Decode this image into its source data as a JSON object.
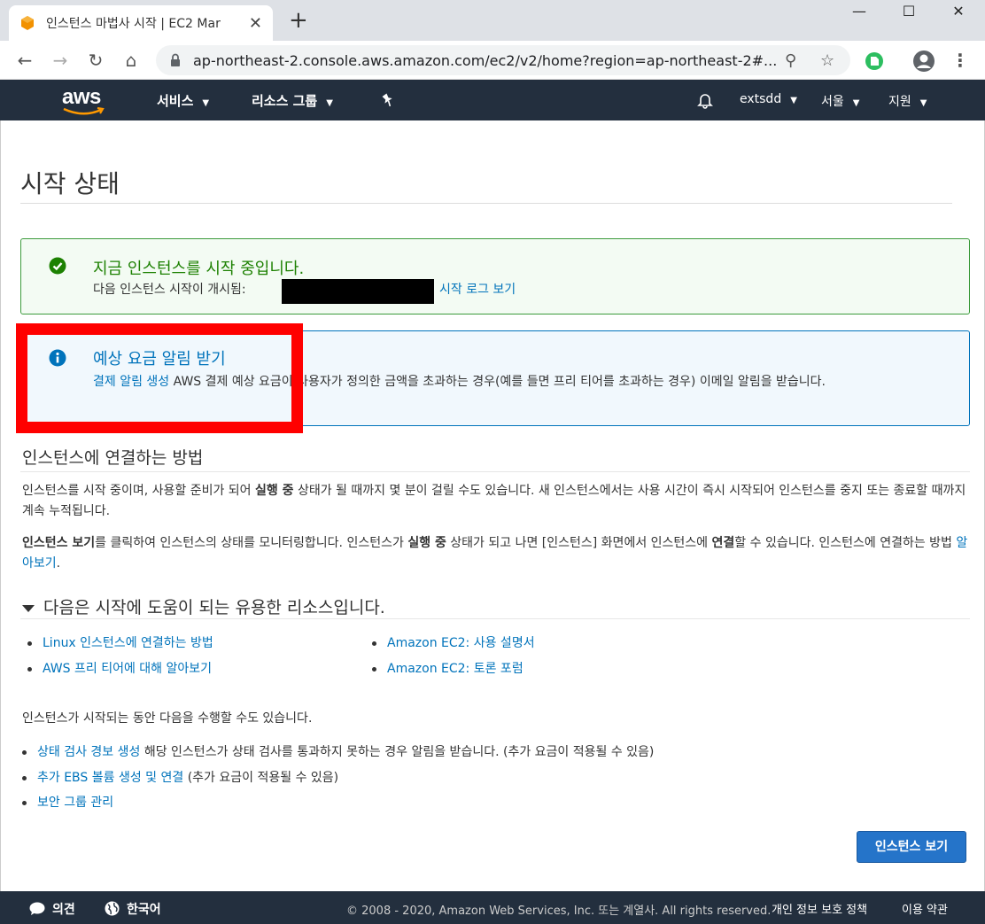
{
  "browser": {
    "tab_title": "인스턴스 마법사 시작 | EC2 Mar",
    "url": "ap-northeast-2.console.aws.amazon.com/ec2/v2/home?region=ap-northeast-2#..."
  },
  "aws_nav": {
    "logo": "aws",
    "services": "서비스",
    "resource_groups": "리소스 그룹",
    "account": "extsdd",
    "region": "서울",
    "support": "지원"
  },
  "page": {
    "title": "시작 상태",
    "success": {
      "title": "지금 인스턴스를 시작 중입니다.",
      "message": "다음 인스턴스 시작이 개시됨:",
      "log_link": "시작 로그 보기"
    },
    "info": {
      "title": "예상 요금 알림 받기",
      "link": "결제 알림 생성",
      "message": "AWS 결제 예상 요금이 사용자가 정의한 금액을 초과하는 경우(예를 들면 프리 티어를 초과하는 경우) 이메일 알림을 받습니다."
    },
    "connect": {
      "title": "인스턴스에 연결하는 방법",
      "p1_a": "인스턴스를 시작 중이며, 사용할 준비가 되어 ",
      "p1_bold": "실행 중",
      "p1_b": " 상태가 될 때까지 몇 분이 걸릴 수도 있습니다. 새 인스턴스에서는 사용 시간이 즉시 시작되어 인스턴스를 중지 또는 종료할 때까지 계속 누적됩니다.",
      "p2_bold1": "인스턴스 보기",
      "p2_a": "를 클릭하여 인스턴스의 상태를 모니터링합니다. 인스턴스가 ",
      "p2_bold2": "실행 중",
      "p2_b": " 상태가 되고 나면 [인스턴스] 화면에서 인스턴스에 ",
      "p2_bold3": "연결",
      "p2_c": "할 수 있습니다. 인스턴스에 연결하는 방법 ",
      "p2_link": "알아보기",
      "p2_end": "."
    },
    "resources": {
      "title": "다음은 시작에 도움이 되는 유용한 리소스입니다.",
      "links": [
        "Linux 인스턴스에 연결하는 방법",
        "AWS 프리 티어에 대해 알아보기",
        "Amazon EC2: 사용 설명서",
        "Amazon EC2: 토론 포럼"
      ]
    },
    "todo": {
      "title": "인스턴스가 시작되는 동안 다음을 수행할 수도 있습니다.",
      "items": [
        {
          "link": "상태 검사 경보 생성",
          "text": " 해당 인스턴스가 상태 검사를 통과하지 못하는 경우 알림을 받습니다. (추가 요금이 적용될 수 있음)"
        },
        {
          "link": "추가 EBS 볼륨 생성 및 연결",
          "text": " (추가 요금이 적용될 수 있음)"
        },
        {
          "link": "보안 그룹 관리",
          "text": ""
        }
      ]
    },
    "view_button": "인스턴스 보기"
  },
  "footer": {
    "feedback": "의견",
    "language": "한국어",
    "copyright": "© 2008 - 2020, Amazon Web Services, Inc. 또는 계열사. All rights reserved.",
    "privacy": "개인 정보 보호 정책",
    "terms": "이용 약관"
  }
}
